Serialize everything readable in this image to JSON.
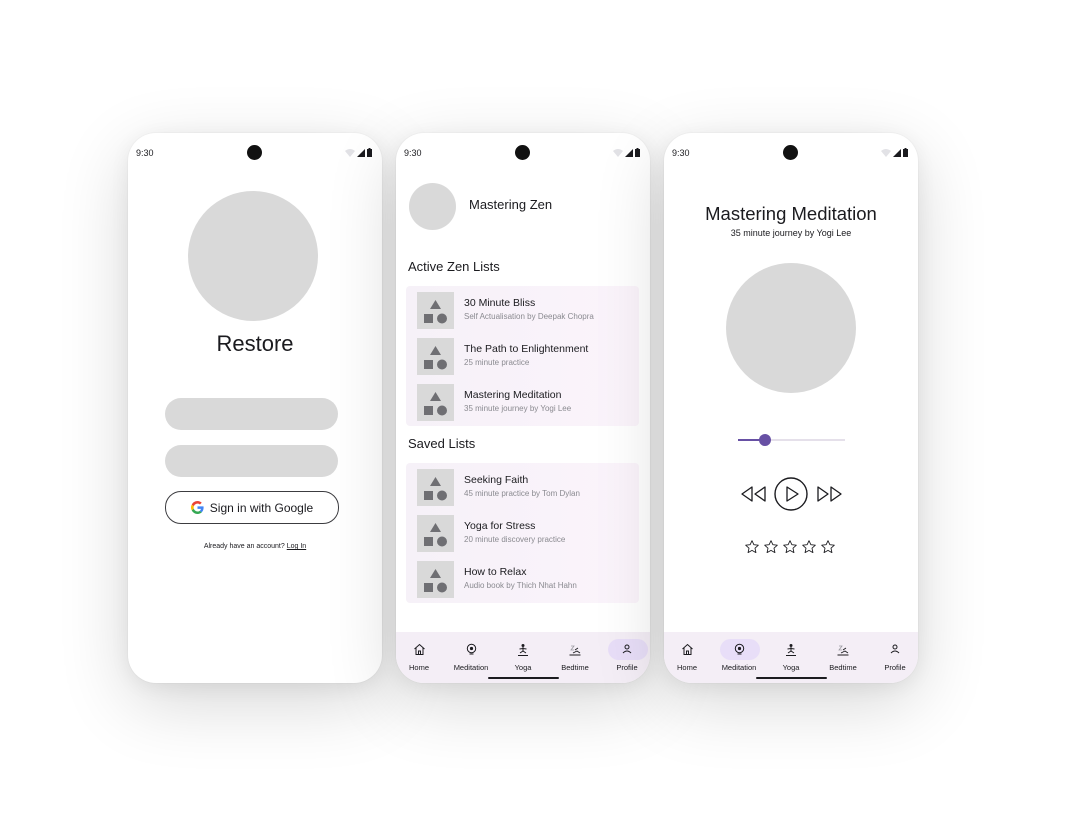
{
  "status": {
    "time": "9:30"
  },
  "screen1": {
    "title": "Restore",
    "google_button": "Sign in with Google",
    "already_text": "Already have an account?",
    "login_link": "Log In"
  },
  "screen2": {
    "profile_name": "Mastering Zen",
    "active_title": "Active Zen Lists",
    "active_items": [
      {
        "title": "30 Minute Bliss",
        "subtitle": "Self Actualisation by Deepak Chopra"
      },
      {
        "title": "The Path to Enlightenment",
        "subtitle": "25 minute practice"
      },
      {
        "title": "Mastering Meditation",
        "subtitle": "35 minute journey by Yogi Lee"
      }
    ],
    "saved_title": "Saved Lists",
    "saved_items": [
      {
        "title": "Seeking Faith",
        "subtitle": "45 minute practice by Tom Dylan"
      },
      {
        "title": "Yoga for Stress",
        "subtitle": "20 minute discovery practice"
      },
      {
        "title": "How to Relax",
        "subtitle": "Audio book by Thich Nhat Hahn"
      }
    ]
  },
  "screen3": {
    "title": "Mastering Meditation",
    "subtitle": "35 minute journey by Yogi Lee",
    "progress_fraction": 0.25,
    "rating": {
      "filled": 0,
      "total": 5
    }
  },
  "nav": {
    "items": [
      {
        "label": "Home",
        "icon": "home-icon"
      },
      {
        "label": "Meditation",
        "icon": "meditation-icon"
      },
      {
        "label": "Yoga",
        "icon": "yoga-icon"
      },
      {
        "label": "Bedtime",
        "icon": "bedtime-icon"
      },
      {
        "label": "Profile",
        "icon": "profile-icon"
      }
    ]
  },
  "colors": {
    "accent": "#6750a4",
    "nav_bg": "#f4eef6",
    "nav_active": "#e8def8",
    "placeholder": "#d9d9d9"
  }
}
